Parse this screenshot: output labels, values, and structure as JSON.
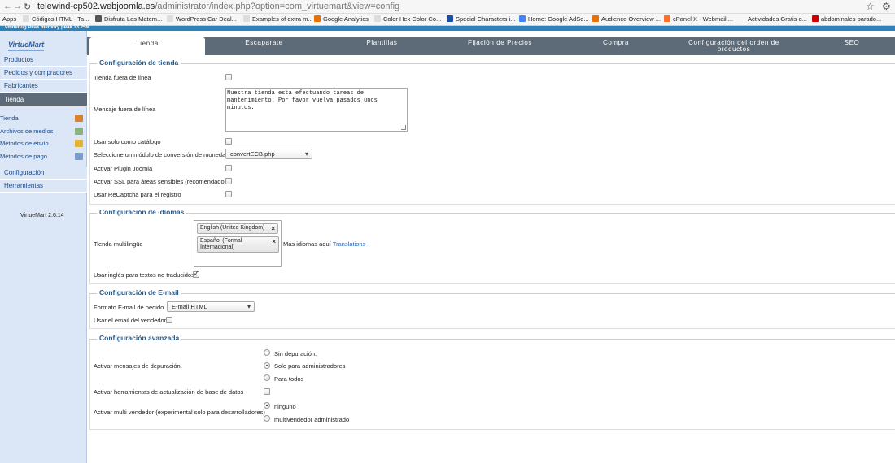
{
  "browser": {
    "url_host": "telewind-cp502.webjoomla.es",
    "url_path": "/administrator/index.php?option=com_virtuemart&view=config",
    "bookmarks": [
      {
        "label": "Apps",
        "color": ""
      },
      {
        "label": "Códigos HTML - Ta...",
        "color": "#dddddd"
      },
      {
        "label": "Disfruta Las Matem...",
        "color": "#555555"
      },
      {
        "label": "WordPress Car Deal...",
        "color": "#dddddd"
      },
      {
        "label": "Examples of extra m...",
        "color": "#dddddd"
      },
      {
        "label": "Google Analytics",
        "color": "#e8710a"
      },
      {
        "label": "Color Hex Color Co...",
        "color": "#dddddd"
      },
      {
        "label": "Special Characters i...",
        "color": "#1a4fa3"
      },
      {
        "label": "Home: Google AdSe...",
        "color": "#4285f4"
      },
      {
        "label": "Audience Overview ...",
        "color": "#e8710a"
      },
      {
        "label": "cPanel X - Webmail ...",
        "color": "#ff6c2c"
      },
      {
        "label": "Actividades Gratis o...",
        "color": ""
      },
      {
        "label": "abdominales parado...",
        "color": "#cc0000"
      }
    ]
  },
  "debug_banner": "vmdebug Peak memory peak 13.25M",
  "sidebar": {
    "logo": "VirtueMart",
    "nav": [
      {
        "label": "Productos"
      },
      {
        "label": "Pedidos y compradores"
      },
      {
        "label": "Fabricantes"
      },
      {
        "label": "Tienda"
      }
    ],
    "sub": [
      {
        "label": "Tienda",
        "color": "#d9822b"
      },
      {
        "label": "Archivos de medios",
        "color": "#8ab27a"
      },
      {
        "label": "Métodos de envío",
        "color": "#e0b53a"
      },
      {
        "label": "Métodos de pago",
        "color": "#7a9cc6"
      }
    ],
    "nav2": [
      {
        "label": "Configuración"
      },
      {
        "label": "Herramientas"
      }
    ],
    "version": "VirtueMart 2.6.14"
  },
  "tabs": [
    {
      "label": "Tienda"
    },
    {
      "label": "Escaparate"
    },
    {
      "label": "Plantillas"
    },
    {
      "label": "Fijación de Precios"
    },
    {
      "label": "Compra"
    },
    {
      "label": "Configuración del orden de productos"
    },
    {
      "label": "SEO"
    }
  ],
  "shop": {
    "legend": "Configuración de tienda",
    "offline_label": "Tienda fuera de línea",
    "offline_checked": false,
    "offline_msg_label": "Mensaje fuera de línea",
    "offline_msg_value": "Nuestra tienda esta efectuando tareas de mantenimiento. Por favor vuelva pasados unos minutos.",
    "catalog_label": "Usar solo como catálogo",
    "catalog_checked": false,
    "currency_label": "Seleccione un módulo de conversión de moneda",
    "currency_value": "convertECB.php",
    "joomla_plugin_label": "Activar Plugin Joomla",
    "ssl_label": "Activar SSL para áreas sensibles (recomendado)",
    "recaptcha_label": "Usar ReCaptcha para el registro"
  },
  "languages": {
    "legend": "Configuración de idiomas",
    "multilang_label": "Tienda multilingüe",
    "selected": [
      "English (United Kingdom)",
      "Español (Formal Internacional)"
    ],
    "more_text": "Más idiomas aquí",
    "more_link": "Translations",
    "use_english_label": "Usar inglés para textos no traducidos",
    "use_english_checked": true
  },
  "email": {
    "legend": "Configuración de E-mail",
    "format_label": "Formato E-mail de pedido",
    "format_value": "E-mail HTML",
    "vendor_email_label": "Usar el email del vendedor",
    "vendor_email_checked": false
  },
  "advanced": {
    "legend": "Configuración avanzada",
    "debug_label": "Activar mensajes de depuración.",
    "debug_options": [
      "Sin depuración.",
      "Solo para administradores",
      "Para todos"
    ],
    "debug_selected": 1,
    "db_tools_label": "Activar herramientas de actualización de base de datos",
    "multivendor_label": "Activar multi vendedor (experimental solo para desarrolladores)",
    "multivendor_options": [
      "ninguno",
      "multivendedor administrado"
    ],
    "multivendor_selected": 0
  }
}
